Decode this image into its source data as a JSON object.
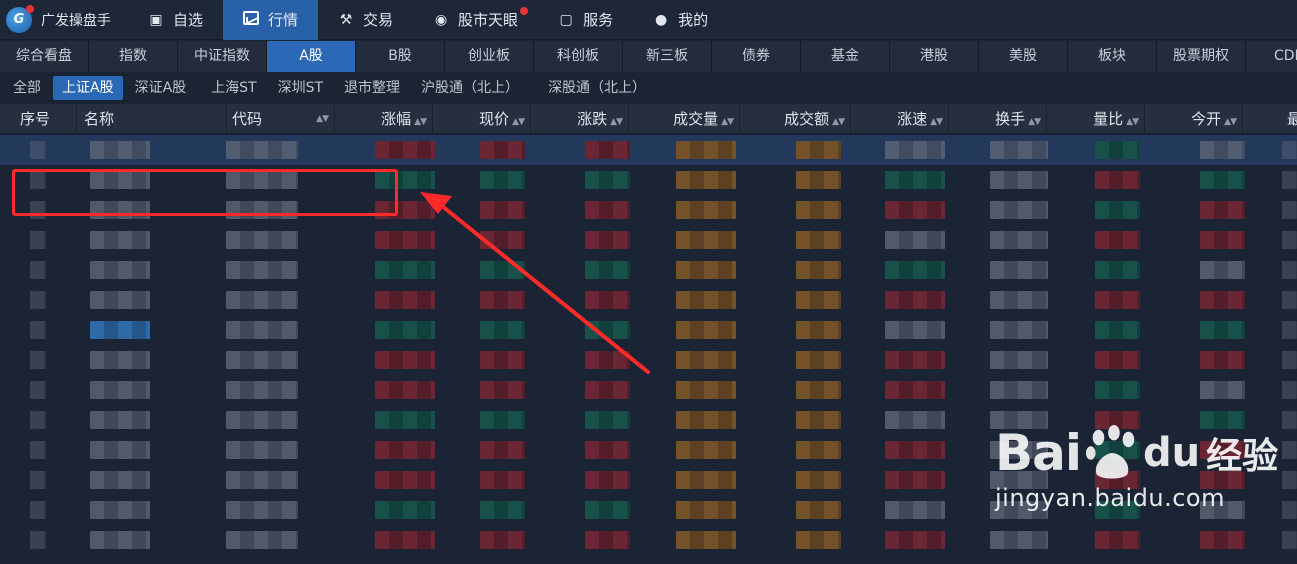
{
  "app": {
    "brand_logo_text": "G",
    "brand_name": "广发操盘手"
  },
  "topnav": [
    {
      "id": "favorites",
      "label": "自选",
      "icon": "star-square-icon",
      "active": false,
      "badge": false
    },
    {
      "id": "market",
      "label": "行情",
      "icon": "line-chart-icon",
      "active": true,
      "badge": false
    },
    {
      "id": "trade",
      "label": "交易",
      "icon": "gavel-icon",
      "active": false,
      "badge": false
    },
    {
      "id": "eye",
      "label": "股市天眼",
      "icon": "eye-icon",
      "active": false,
      "badge": true
    },
    {
      "id": "service",
      "label": "服务",
      "icon": "briefcase-icon",
      "active": false,
      "badge": false
    },
    {
      "id": "me",
      "label": "我的",
      "icon": "user-icon",
      "active": false,
      "badge": false
    }
  ],
  "category_tabs": [
    {
      "label": "综合看盘",
      "active": false
    },
    {
      "label": "指数",
      "active": false
    },
    {
      "label": "中证指数",
      "active": false
    },
    {
      "label": "A股",
      "active": true
    },
    {
      "label": "B股",
      "active": false
    },
    {
      "label": "创业板",
      "active": false
    },
    {
      "label": "科创板",
      "active": false
    },
    {
      "label": "新三板",
      "active": false
    },
    {
      "label": "债券",
      "active": false
    },
    {
      "label": "基金",
      "active": false
    },
    {
      "label": "港股",
      "active": false
    },
    {
      "label": "美股",
      "active": false
    },
    {
      "label": "板块",
      "active": false
    },
    {
      "label": "股票期权",
      "active": false
    },
    {
      "label": "CDR",
      "active": false
    }
  ],
  "sub_tabs": [
    {
      "label": "全部",
      "active": false
    },
    {
      "label": "上证A股",
      "active": true
    },
    {
      "label": "深证A股",
      "active": false
    },
    {
      "label": "上海ST",
      "active": false
    },
    {
      "label": "深圳ST",
      "active": false
    },
    {
      "label": "退市整理",
      "active": false
    },
    {
      "label": "沪股通（北上）",
      "active": false
    },
    {
      "label": "深股通（北上）",
      "active": false
    }
  ],
  "table": {
    "columns": [
      {
        "label": "序号",
        "sortable": false
      },
      {
        "label": "名称",
        "sortable": false
      },
      {
        "label": "代码",
        "sortable": true
      },
      {
        "label": "涨幅",
        "sortable": true
      },
      {
        "label": "现价",
        "sortable": true
      },
      {
        "label": "涨跌",
        "sortable": true
      },
      {
        "label": "成交量",
        "sortable": true
      },
      {
        "label": "成交额",
        "sortable": true
      },
      {
        "label": "涨速",
        "sortable": true
      },
      {
        "label": "换手",
        "sortable": true
      },
      {
        "label": "量比",
        "sortable": true
      },
      {
        "label": "今开",
        "sortable": true
      },
      {
        "label": "最高",
        "sortable": true
      }
    ],
    "visible_row_count": 14,
    "selected_row": 0,
    "rows_obscured": true
  },
  "annotation": {
    "highlight_color": "#ff2a2a",
    "arrow_color": "#ff2a2a"
  },
  "watermark": {
    "logo_text_bai": "Bai",
    "logo_text_du": "du",
    "logo_text_jingyan": "经验",
    "url": "jingyan.baidu.com"
  },
  "colors": {
    "active_nav": "#2860a9",
    "active_tab": "#2b68b6",
    "background": "#1b2434",
    "up_red": "#e8323a"
  }
}
